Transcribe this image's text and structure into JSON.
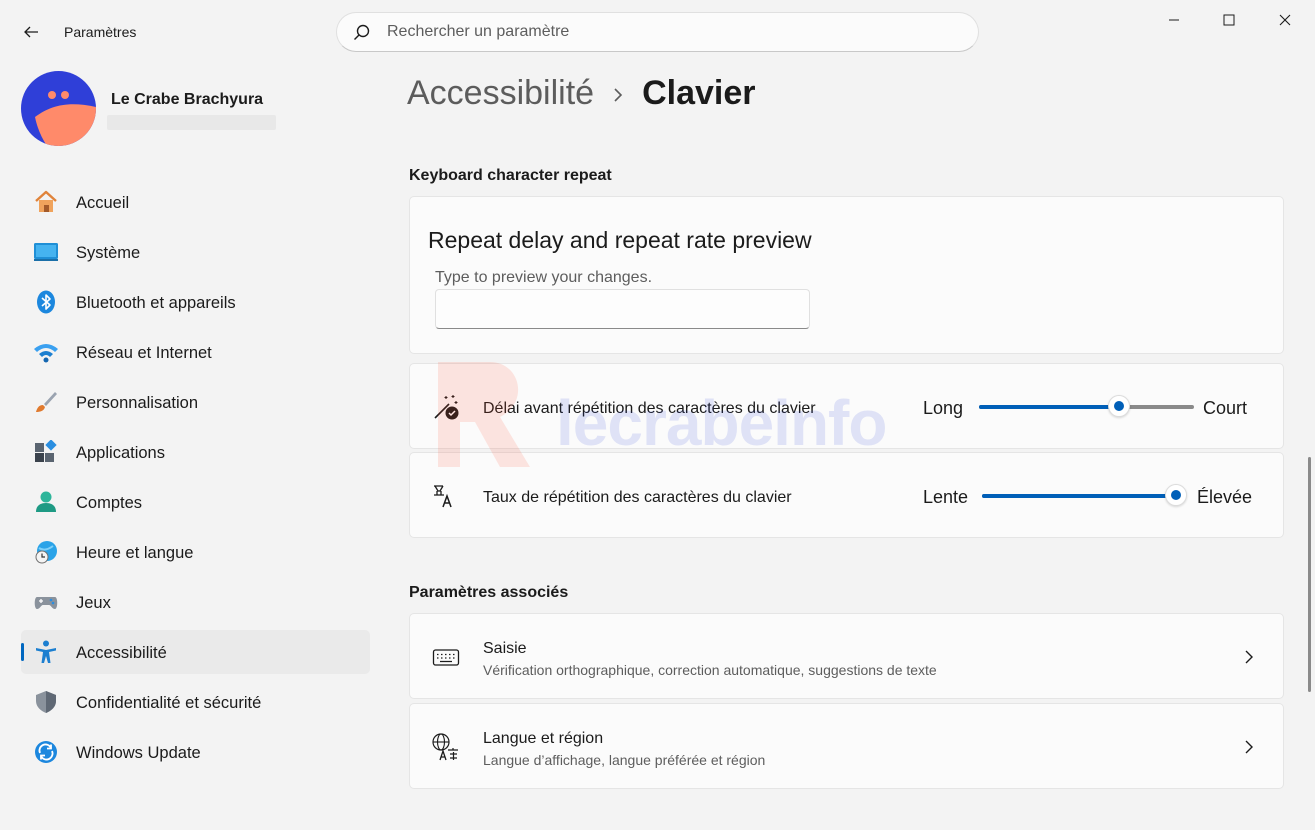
{
  "app": {
    "title": "Paramètres"
  },
  "search": {
    "placeholder": "Rechercher un paramètre"
  },
  "profile": {
    "name": "Le Crabe Brachyura"
  },
  "sidebar": {
    "items": [
      {
        "label": "Accueil",
        "icon": "home-icon"
      },
      {
        "label": "Système",
        "icon": "system-icon"
      },
      {
        "label": "Bluetooth et appareils",
        "icon": "bluetooth-icon"
      },
      {
        "label": "Réseau et Internet",
        "icon": "wifi-icon"
      },
      {
        "label": "Personnalisation",
        "icon": "brush-icon"
      },
      {
        "label": "Applications",
        "icon": "apps-icon"
      },
      {
        "label": "Comptes",
        "icon": "account-icon"
      },
      {
        "label": "Heure et langue",
        "icon": "time-language-icon"
      },
      {
        "label": "Jeux",
        "icon": "gamepad-icon"
      },
      {
        "label": "Accessibilité",
        "icon": "accessibility-icon",
        "active": true
      },
      {
        "label": "Confidentialité et sécurité",
        "icon": "shield-icon"
      },
      {
        "label": "Windows Update",
        "icon": "update-icon"
      }
    ]
  },
  "breadcrumb": {
    "parent": "Accessibilité",
    "current": "Clavier"
  },
  "repeat_section": {
    "title": "Keyboard character repeat",
    "preview": {
      "title": "Repeat delay and repeat rate preview",
      "label": "Type to preview your changes.",
      "value": ""
    },
    "delay": {
      "label": "Délai avant répétition des caractères du clavier",
      "min_label": "Long",
      "max_label": "Court",
      "value_fraction": 0.65
    },
    "rate": {
      "label": "Taux de répétition des caractères du clavier",
      "min_label": "Lente",
      "max_label": "Élevée",
      "value_fraction": 1.0
    }
  },
  "related": {
    "title": "Paramètres associés",
    "items": [
      {
        "title": "Saisie",
        "subtitle": "Vérification orthographique, correction automatique, suggestions de texte",
        "icon": "keyboard-icon"
      },
      {
        "title": "Langue et région",
        "subtitle": "Langue d’affichage, langue préférée et région",
        "icon": "language-icon"
      }
    ]
  },
  "watermark": {
    "text": "lecrabeinfo"
  },
  "colors": {
    "accent": "#005fb8",
    "background": "#f3f3f3",
    "card": "#fbfbfb"
  }
}
